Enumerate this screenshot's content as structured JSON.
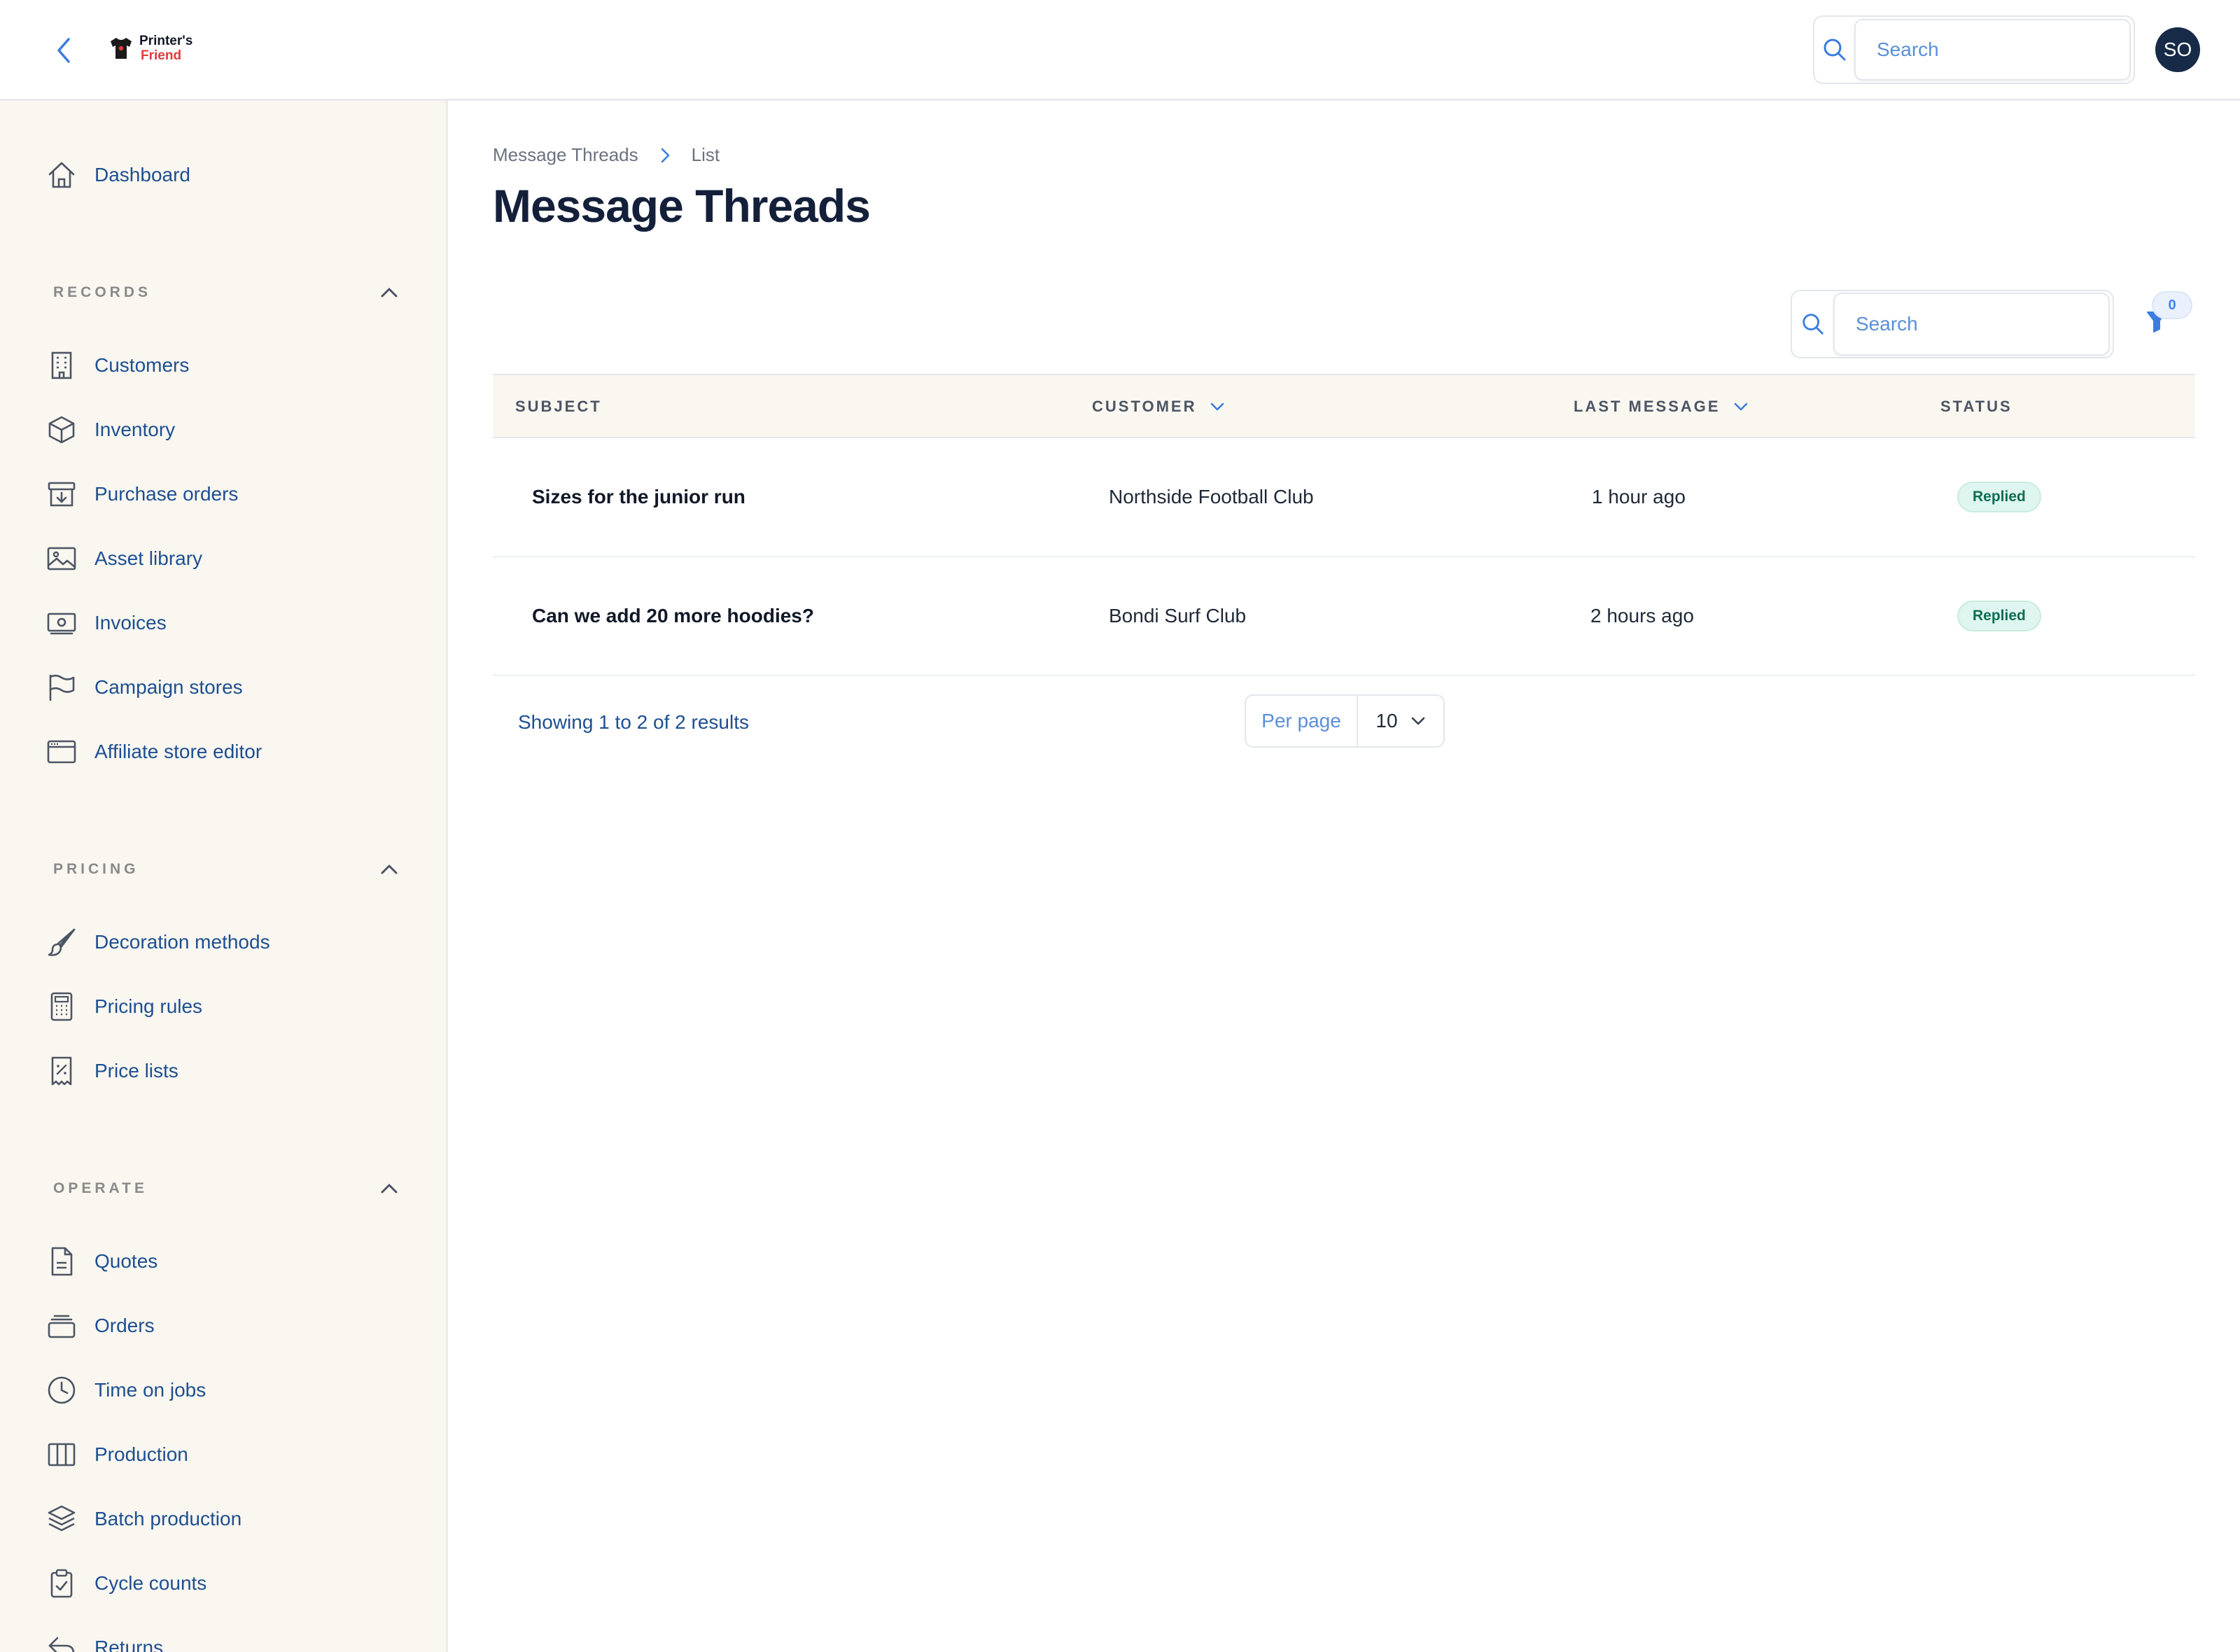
{
  "header": {
    "logo_line1": "Printer's",
    "logo_line2": "Friend",
    "search_placeholder": "Search",
    "avatar_initials": "SO"
  },
  "sidebar": {
    "dashboard": "Dashboard",
    "sections": [
      {
        "title": "RECORDS",
        "items": [
          "Customers",
          "Inventory",
          "Purchase orders",
          "Asset library",
          "Invoices",
          "Campaign stores",
          "Affiliate store editor"
        ]
      },
      {
        "title": "PRICING",
        "items": [
          "Decoration methods",
          "Pricing rules",
          "Price lists"
        ]
      },
      {
        "title": "OPERATE",
        "items": [
          "Quotes",
          "Orders",
          "Time on jobs",
          "Production",
          "Batch production",
          "Cycle counts",
          "Returns"
        ]
      }
    ]
  },
  "breadcrumb": {
    "root": "Message Threads",
    "current": "List"
  },
  "page_title": "Message Threads",
  "toolbar": {
    "search_placeholder": "Search",
    "filter_count": "0"
  },
  "table": {
    "columns": [
      "SUBJECT",
      "CUSTOMER",
      "LAST MESSAGE",
      "STATUS"
    ],
    "rows": [
      {
        "subject": "Sizes for the junior run",
        "customer": "Northside Football Club",
        "last_message": "1 hour ago",
        "status": "Replied"
      },
      {
        "subject": "Can we add 20 more hoodies?",
        "customer": "Bondi Surf Club",
        "last_message": "2 hours ago",
        "status": "Replied"
      }
    ]
  },
  "pagination": {
    "summary": "Showing 1 to 2 of 2 results",
    "per_page_label": "Per page",
    "per_page_value": "10"
  },
  "colors": {
    "accent": "#1d4f91",
    "sidebar_bg": "#faf6f0",
    "status_replied_bg": "#dff5ef",
    "status_replied_text": "#0f6e55",
    "avatar_bg": "#172a48"
  }
}
